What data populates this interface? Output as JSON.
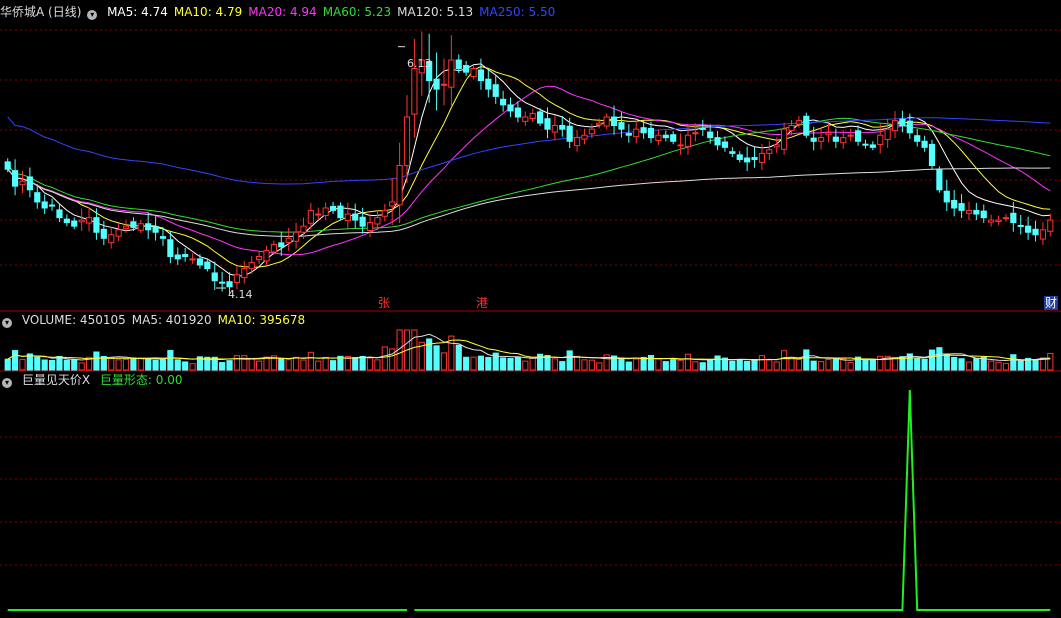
{
  "price_header": {
    "stock": "华侨城A",
    "period": "(日线)",
    "indicators": [
      {
        "label": "MA5: 4.74",
        "color": "#ffffff"
      },
      {
        "label": "MA10: 4.79",
        "color": "#ffff33"
      },
      {
        "label": "MA20: 4.94",
        "color": "#ff33ff"
      },
      {
        "label": "MA60: 5.23",
        "color": "#33dd33"
      },
      {
        "label": "MA120: 5.13",
        "color": "#dddddd"
      },
      {
        "label": "MA250: 5.50",
        "color": "#3344ff"
      }
    ]
  },
  "volume_header": {
    "indicators": [
      {
        "label": "VOLUME: 450105",
        "color": "#dddddd"
      },
      {
        "label": "MA5: 401920",
        "color": "#dddddd"
      },
      {
        "label": "MA10: 395678",
        "color": "#ffff33"
      }
    ]
  },
  "signal_header": {
    "title": "巨量见天价X",
    "indicators": [
      {
        "label": "巨量形态: 0.00",
        "color": "#33dd33"
      }
    ]
  },
  "annotations": {
    "high_label": "6.13",
    "low_label": "4.14",
    "event_1": "张",
    "event_2": "港",
    "event_3": "财"
  },
  "colors": {
    "up": "#ff3333",
    "down": "#54ffff",
    "grid": "#880000",
    "signal": "#22ee22"
  },
  "chart_data": {
    "type": "candlestick",
    "price": {
      "close": [
        5.12,
        4.98,
        5.02,
        4.95,
        4.85,
        4.8,
        4.82,
        4.72,
        4.68,
        4.65,
        4.7,
        4.72,
        4.6,
        4.55,
        4.58,
        4.62,
        4.65,
        4.64,
        4.67,
        4.62,
        4.6,
        4.55,
        4.4,
        4.38,
        4.4,
        4.38,
        4.33,
        4.3,
        4.2,
        4.18,
        4.15,
        4.25,
        4.3,
        4.35,
        4.4,
        4.45,
        4.5,
        4.48,
        4.55,
        4.6,
        4.65,
        4.78,
        4.75,
        4.8,
        4.78,
        4.72,
        4.75,
        4.7,
        4.65,
        4.68,
        4.72,
        4.78,
        4.85,
        5.15,
        5.55,
        5.95,
        6.02,
        5.85,
        5.78,
        5.82,
        6.02,
        5.95,
        5.92,
        5.95,
        5.85,
        5.78,
        5.72,
        5.65,
        5.6,
        5.55,
        5.55,
        5.58,
        5.5,
        5.45,
        5.48,
        5.45,
        5.35,
        5.38,
        5.4,
        5.45,
        5.5,
        5.55,
        5.48,
        5.45,
        5.4,
        5.45,
        5.42,
        5.38,
        5.4,
        5.38,
        5.35,
        5.32,
        5.4,
        5.42,
        5.45,
        5.38,
        5.32,
        5.3,
        5.25,
        5.2,
        5.18,
        5.2,
        5.25,
        5.28,
        5.32,
        5.45,
        5.48,
        5.52,
        5.4,
        5.35,
        5.38,
        5.42,
        5.35,
        5.38,
        5.4,
        5.35,
        5.32,
        5.3,
        5.4,
        5.45,
        5.52,
        5.48,
        5.42,
        5.35,
        5.3,
        5.15,
        4.95,
        4.85,
        4.8,
        4.78,
        4.78,
        4.75,
        4.72,
        4.7,
        4.7,
        4.72,
        4.68,
        4.65,
        4.6,
        4.58,
        4.62,
        4.7
      ]
    },
    "moving_averages": [
      {
        "name": "MA5",
        "last": 4.74
      },
      {
        "name": "MA10",
        "last": 4.79
      },
      {
        "name": "MA20",
        "last": 4.94
      },
      {
        "name": "MA60",
        "last": 5.23
      },
      {
        "name": "MA120",
        "last": 5.13
      },
      {
        "name": "MA250",
        "last": 5.5
      }
    ],
    "annotated_high": 6.13,
    "annotated_low": 4.14,
    "volume_peak_index": 55,
    "signal": {
      "name": "巨量形态",
      "peak_index": 122,
      "peak_value": 1,
      "baseline": 0,
      "gap_index": 55
    }
  }
}
